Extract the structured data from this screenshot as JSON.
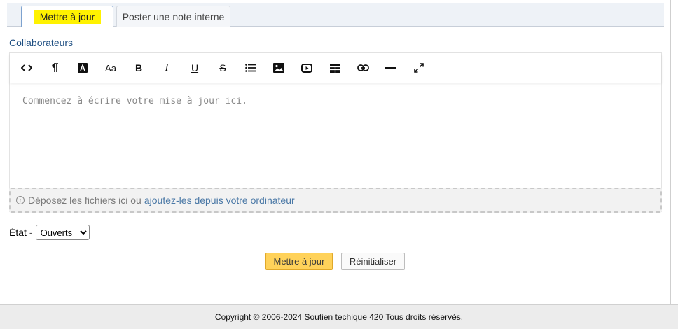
{
  "tabs": {
    "active_label": "Mettre à jour",
    "inactive_label": "Poster une note interne",
    "highlight_color": "#fff200"
  },
  "form": {
    "collaborators_label": "Collaborateurs",
    "editor": {
      "placeholder": "Commencez à écrire votre mise à jour ici.",
      "toolbar": [
        {
          "name": "code-view-icon"
        },
        {
          "name": "paragraph-icon"
        },
        {
          "name": "text-color-icon"
        },
        {
          "name": "font-size-icon",
          "text": "Aa"
        },
        {
          "name": "bold-icon",
          "text": "B"
        },
        {
          "name": "italic-icon",
          "text": "I"
        },
        {
          "name": "underline-icon",
          "text": "U"
        },
        {
          "name": "strikethrough-icon",
          "text": "S"
        },
        {
          "name": "unordered-list-icon"
        },
        {
          "name": "image-icon"
        },
        {
          "name": "video-icon"
        },
        {
          "name": "table-icon"
        },
        {
          "name": "link-icon"
        },
        {
          "name": "horizontal-rule-icon"
        },
        {
          "name": "fullscreen-icon"
        }
      ]
    },
    "dropzone": {
      "text": "Déposez les fichiers ici ou",
      "link": "ajoutez-les depuis votre ordinateur"
    },
    "state": {
      "label": "État",
      "separator": "-",
      "selected": "Ouverts"
    },
    "buttons": {
      "submit": "Mettre à jour",
      "reset": "Réinitialiser"
    }
  },
  "footer": {
    "text": "Copyright © 2006-2024 Soutien techique 420 Tous droits réservés."
  }
}
